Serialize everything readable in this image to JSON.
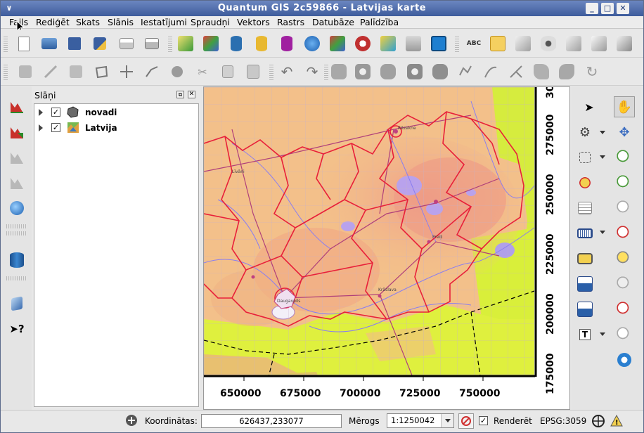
{
  "window": {
    "title": "Quantum GIS 2c59866 - Latvijas karte"
  },
  "menu": {
    "items": [
      "Fails",
      "Rediģēt",
      "Skats",
      "Slānis",
      "Iestatījumi",
      "Spraudņi",
      "Vektors",
      "Rastrs",
      "Datubāze",
      "Palīdzība"
    ]
  },
  "toolbar1": {
    "icons": [
      "new-project-icon",
      "open-project-icon",
      "save-project-icon",
      "save-as-icon",
      "print-composer-icon",
      "print-icon",
      "add-vector-layer-icon",
      "add-raster-layer-icon",
      "add-postgis-layer-icon",
      "add-spatialite-layer-icon",
      "add-mssql-layer-icon",
      "add-wms-layer-icon",
      "add-wcs-layer-icon",
      "add-wfs-layer-icon",
      "new-shapefile-icon",
      "remove-layer-icon",
      "add-delimited-text-icon",
      "label-icon",
      "label-tool-icon",
      "pin-label-icon",
      "show-hide-labels-icon",
      "move-label-icon",
      "rotate-label-icon",
      "change-label-icon"
    ]
  },
  "toolbar2": {
    "icons": [
      "save-edits-icon",
      "toggle-editing-icon",
      "save-layer-icon",
      "add-feature-icon",
      "move-feature-icon",
      "node-tool-icon",
      "delete-selected-icon",
      "cut-features-icon",
      "copy-features-icon",
      "paste-features-icon",
      "undo-icon",
      "redo-icon",
      "simplify-feature-icon",
      "add-ring-icon",
      "add-part-icon",
      "delete-ring-icon",
      "delete-part-icon",
      "reshape-features-icon",
      "offset-curve-icon",
      "split-features-icon",
      "merge-features-icon",
      "merge-attributes-icon",
      "rotate-symbols-icon"
    ]
  },
  "layers_panel": {
    "title": "Slāņi",
    "layers": [
      {
        "name": "novadi",
        "checked": true,
        "icon": "vector-polygon-icon"
      },
      {
        "name": "Latvija",
        "checked": true,
        "icon": "raster-layer-icon"
      }
    ]
  },
  "map": {
    "x_ticks": [
      "650000",
      "675000",
      "700000",
      "725000",
      "750000"
    ],
    "y_ticks": [
      "275000",
      "250000",
      "225000",
      "200000",
      "175000"
    ],
    "y_top_partial": "30",
    "labels": [
      "Daugavpils",
      "Līvāni",
      "Krāslava",
      "Rēzekne",
      "Preiļi"
    ]
  },
  "statusbar": {
    "coord_label": "Koordinātas:",
    "coord_value": "626437,233077",
    "scale_label": "Mērogs",
    "scale_value": "1:1250042",
    "render_label": "Renderēt",
    "render_checked": true,
    "crs": "EPSG:3059"
  },
  "colors": {
    "titlebar": "#4a67a8",
    "boundary": "#e8203a",
    "raster_low": "#f5c78a",
    "raster_high": "#ef9a7a",
    "lowland": "#d9ef3a"
  }
}
